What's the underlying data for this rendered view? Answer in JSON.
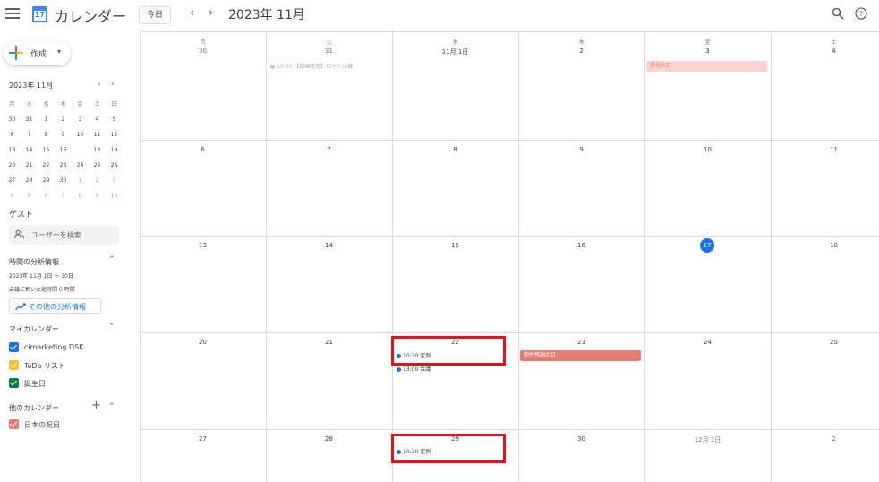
{
  "header": {
    "app_title": "カレンダー",
    "logo_day": "17",
    "today_label": "今日",
    "month_title": "2023年 11月"
  },
  "sidebar": {
    "create_label": "作成",
    "mini_calendar": {
      "title": "2023年 11月",
      "weekdays": [
        "月",
        "火",
        "水",
        "木",
        "金",
        "土",
        "日"
      ],
      "weeks": [
        [
          "30",
          "31",
          "1",
          "2",
          "3",
          "4",
          "5"
        ],
        [
          "6",
          "7",
          "8",
          "9",
          "10",
          "11",
          "12"
        ],
        [
          "13",
          "14",
          "15",
          "16",
          "17",
          "18",
          "19"
        ],
        [
          "20",
          "21",
          "22",
          "23",
          "24",
          "25",
          "26"
        ],
        [
          "27",
          "28",
          "29",
          "30",
          "1",
          "2",
          "3"
        ],
        [
          "4",
          "5",
          "6",
          "7",
          "8",
          "9",
          "10"
        ]
      ]
    },
    "guest_label": "ゲスト",
    "user_search_placeholder": "ユーザーを検索",
    "insights": {
      "title": "時間の分析情報",
      "range": "2023年 11月 1日 ～ 30日",
      "hours": "会議に割いた総時間 0 時間",
      "more_label": "その他の分析情報"
    },
    "my_calendars": {
      "title": "マイカレンダー",
      "items": [
        {
          "label": "cimarketing DSK",
          "color": "#1a73e8"
        },
        {
          "label": "ToDo リスト",
          "color": "#f6bf26"
        },
        {
          "label": "誕生日",
          "color": "#0b8043"
        }
      ]
    },
    "other_calendars": {
      "title": "他のカレンダー",
      "items": [
        {
          "label": "日本の祝日",
          "color": "#e67c73"
        }
      ]
    }
  },
  "month": {
    "weekdays": [
      "月",
      "火",
      "水",
      "木",
      "金",
      "土"
    ],
    "rows": [
      [
        "30",
        "31",
        "11月 1日",
        "2",
        "3",
        "4"
      ],
      [
        "6",
        "7",
        "8",
        "9",
        "10",
        "11"
      ],
      [
        "13",
        "14",
        "15",
        "16",
        "17",
        "18"
      ],
      [
        "20",
        "21",
        "22",
        "23",
        "24",
        "25"
      ],
      [
        "27",
        "28",
        "29",
        "30",
        "12月 1日",
        "2"
      ]
    ],
    "holidays": {
      "culture_day": "文化の日",
      "labor_thanks_day": "勤労感謝の日"
    },
    "events": {
      "recording_event": "10:00 【録画使用】ロイヤル様",
      "weekly_22": "10:30 定例",
      "meeting_22": "13:00 会議",
      "weekly_29": "10:30 定例"
    }
  },
  "colors": {
    "accent": "#1a73e8",
    "holiday_light": "#fad2cf",
    "holiday_strong": "#e67c73",
    "highlight": "#e8111a"
  }
}
